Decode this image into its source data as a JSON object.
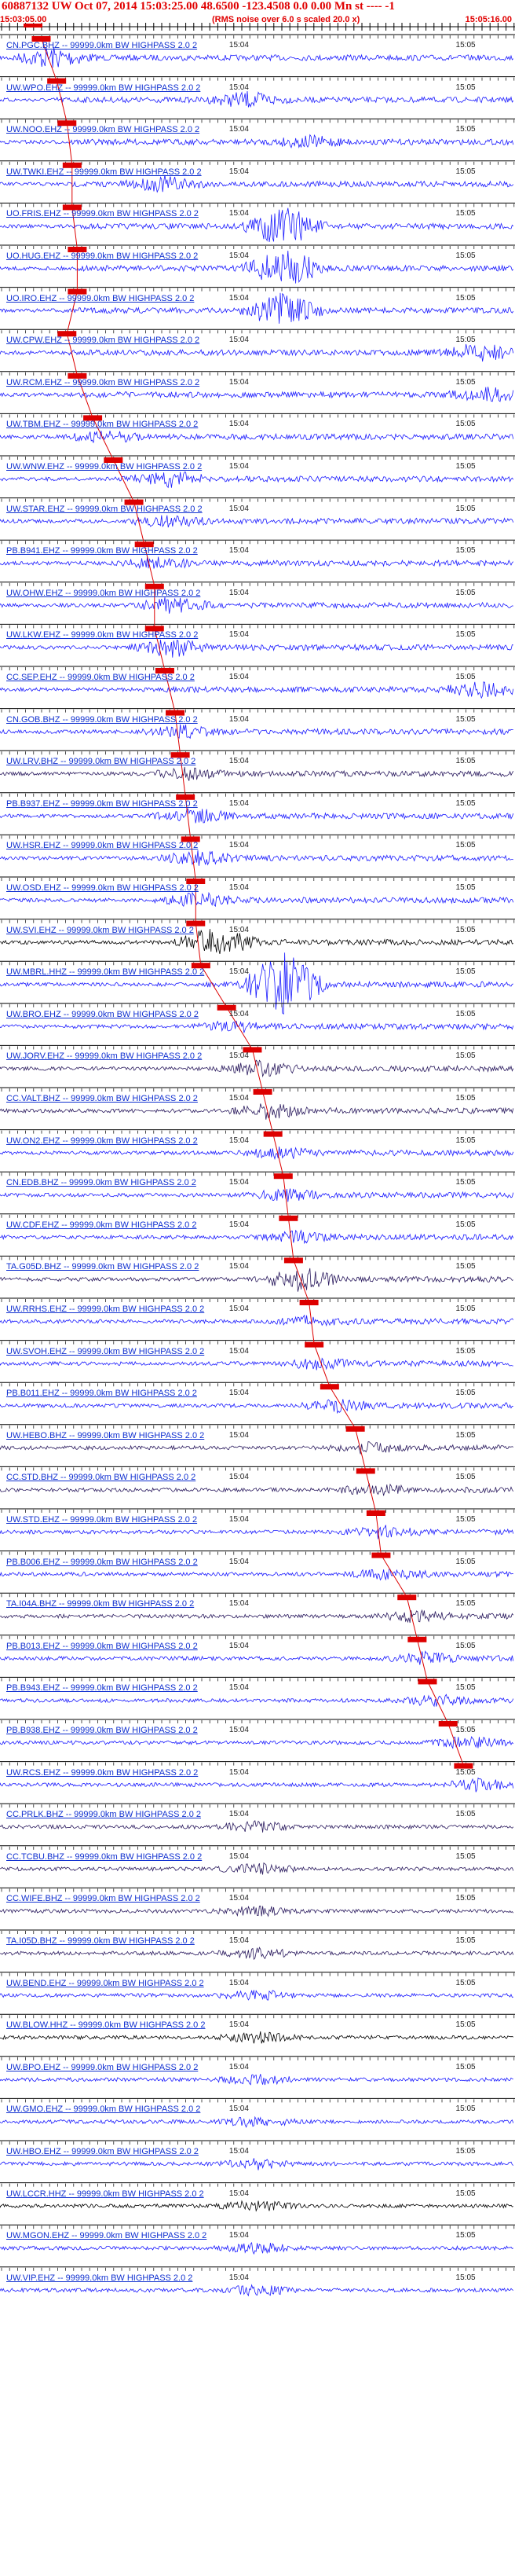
{
  "header": {
    "title": "60887132 UW Oct 07, 2014 15:03:25.00   48.6500 -123.4508  0.0 0.00 Mn st ----  -1",
    "start_time": "15:03:05.00",
    "noise_note": "(RMS noise over 6.0 s scaled 20.0 x)",
    "end_time": "15:05:16.00"
  },
  "time_tick_labels": [
    "15:04",
    "15:05"
  ],
  "colors": {
    "title": "#e00000",
    "label": "#1030d0",
    "trace_blue": "#1a1aff",
    "trace_dark": "#2a1a5e",
    "trace_black": "#000000",
    "pick": "#dd0000"
  },
  "channels": [
    {
      "label": "CN.PGC.BHZ -- 99999.0km BW  HIGHPASS  2.0  2",
      "color": "#1a1aff",
      "amp": 6,
      "burst": 0.1,
      "pick": 0.08
    },
    {
      "label": "UW.WPO.EHZ -- 99999.0km BW  HIGHPASS  2.0  2",
      "color": "#1a1aff",
      "amp": 4,
      "burst": 0.48,
      "pick": 0.11
    },
    {
      "label": "UW.NOO.EHZ -- 99999.0km BW  HIGHPASS  2.0  2",
      "color": "#1a1aff",
      "amp": 3,
      "burst": 0.6,
      "pick": 0.13
    },
    {
      "label": "UW.TWKI.EHZ -- 99999.0km BW  HIGHPASS  2.0  2",
      "color": "#1a1aff",
      "amp": 4,
      "burst": 0.32,
      "pick": 0.14
    },
    {
      "label": "UO.FRIS.EHZ -- 99999.0km BW  HIGHPASS  2.0  2",
      "color": "#1a1aff",
      "amp": 12,
      "burst": 0.55,
      "pick": 0.14
    },
    {
      "label": "UO.HUG.EHZ -- 99999.0km BW  HIGHPASS  2.0  2",
      "color": "#1a1aff",
      "amp": 12,
      "burst": 0.55,
      "pick": 0.15
    },
    {
      "label": "UO.IRO.EHZ -- 99999.0km BW  HIGHPASS  2.0  2",
      "color": "#1a1aff",
      "amp": 10,
      "burst": 0.55,
      "pick": 0.15
    },
    {
      "label": "UW.CPW.EHZ -- 99999.0km BW  HIGHPASS  2.0  2",
      "color": "#1a1aff",
      "amp": 5,
      "burst": 0.93,
      "pick": 0.13
    },
    {
      "label": "UW.RCM.EHZ -- 99999.0km BW  HIGHPASS  2.0  2",
      "color": "#1a1aff",
      "amp": 4,
      "burst": 0.95,
      "pick": 0.15
    },
    {
      "label": "UW.TBM.EHZ -- 99999.0km BW  HIGHPASS  2.0  2",
      "color": "#1a1aff",
      "amp": 3,
      "burst": 0.2,
      "pick": 0.18
    },
    {
      "label": "UW.WNW.EHZ -- 99999.0km BW  HIGHPASS  2.0  2",
      "color": "#1a1aff",
      "amp": 4,
      "burst": 0.33,
      "pick": 0.22
    },
    {
      "label": "UW.STAR.EHZ -- 99999.0km BW  HIGHPASS  2.0  2",
      "color": "#1a1aff",
      "amp": 3,
      "burst": 0.33,
      "pick": 0.26
    },
    {
      "label": "PB.B941.EHZ -- 99999.0km BW  HIGHPASS  2.0  2",
      "color": "#1a1aff",
      "amp": 3,
      "burst": 0.3,
      "pick": 0.28
    },
    {
      "label": "UW.OHW.EHZ -- 99999.0km BW  HIGHPASS  2.0  2",
      "color": "#1a1aff",
      "amp": 4,
      "burst": 0.33,
      "pick": 0.3
    },
    {
      "label": "UW.LKW.EHZ -- 99999.0km BW  HIGHPASS  2.0  2",
      "color": "#1a1aff",
      "amp": 5,
      "burst": 0.33,
      "pick": 0.3
    },
    {
      "label": "CC.SEP.EHZ -- 99999.0km BW  HIGHPASS  2.0  2",
      "color": "#1a1aff",
      "amp": 4,
      "burst": 0.94,
      "pick": 0.32
    },
    {
      "label": "CN.GOB.BHZ -- 99999.0km BW  HIGHPASS  2.0  2",
      "color": "#1a1aff",
      "amp": 3,
      "burst": 0.35,
      "pick": 0.34
    },
    {
      "label": "UW.LRV.BHZ -- 99999.0km BW  HIGHPASS  2.0  2",
      "color": "#2a1a5e",
      "amp": 3,
      "burst": 0.36,
      "pick": 0.35
    },
    {
      "label": "PB.B937.EHZ -- 99999.0km BW  HIGHPASS  2.0  2",
      "color": "#1a1aff",
      "amp": 4,
      "burst": 0.37,
      "pick": 0.36
    },
    {
      "label": "UW.HSR.EHZ -- 99999.0km BW  HIGHPASS  2.0  2",
      "color": "#1a1aff",
      "amp": 4,
      "burst": 0.38,
      "pick": 0.37
    },
    {
      "label": "UW.OSD.EHZ -- 99999.0km BW  HIGHPASS  2.0  2",
      "color": "#1a1aff",
      "amp": 4,
      "burst": 0.38,
      "pick": 0.38
    },
    {
      "label": "UW.SVI.EHZ -- 99999.0km BW  HIGHPASS  2.0  2",
      "color": "#000000",
      "amp": 9,
      "burst": 0.42,
      "pick": 0.38
    },
    {
      "label": "UW.MBRL.HHZ -- 99999.0km BW  HIGHPASS  2.0  2",
      "color": "#1a1aff",
      "amp": 20,
      "burst": 0.55,
      "pick": 0.39
    },
    {
      "label": "UW.BRO.EHZ -- 99999.0km BW  HIGHPASS  2.0  2",
      "color": "#1a1aff",
      "amp": 3,
      "burst": 0.45,
      "pick": 0.44
    },
    {
      "label": "UW.JORV.EHZ -- 99999.0km BW  HIGHPASS  2.0  2",
      "color": "#2a1a5e",
      "amp": 4,
      "burst": 0.5,
      "pick": 0.49
    },
    {
      "label": "CC.VALT.BHZ -- 99999.0km BW  HIGHPASS  2.0  2",
      "color": "#2a1a5e",
      "amp": 4,
      "burst": 0.52,
      "pick": 0.51
    },
    {
      "label": "UW.ON2.EHZ -- 99999.0km BW  HIGHPASS  2.0  2",
      "color": "#1a1aff",
      "amp": 3,
      "burst": 0.54,
      "pick": 0.53
    },
    {
      "label": "CN.EDB.BHZ -- 99999.0km BW  HIGHPASS  2.0  2",
      "color": "#1a1aff",
      "amp": 3,
      "burst": 0.55,
      "pick": 0.55
    },
    {
      "label": "UW.CDF.EHZ -- 99999.0km BW  HIGHPASS  2.0  2",
      "color": "#1a1aff",
      "amp": 3,
      "burst": 0.57,
      "pick": 0.56
    },
    {
      "label": "TA.G05D.BHZ -- 99999.0km BW  HIGHPASS  2.0  2",
      "color": "#2a1a5e",
      "amp": 7,
      "burst": 0.58,
      "pick": 0.57
    },
    {
      "label": "UW.RRHS.EHZ -- 99999.0km BW  HIGHPASS  2.0  2",
      "color": "#1a1aff",
      "amp": 3,
      "burst": 0.6,
      "pick": 0.6
    },
    {
      "label": "UW.SVOH.EHZ -- 99999.0km BW  HIGHPASS  2.0  2",
      "color": "#1a1aff",
      "amp": 3,
      "burst": 0.61,
      "pick": 0.61
    },
    {
      "label": "PB.B011.EHZ -- 99999.0km BW  HIGHPASS  2.0  2",
      "color": "#1a1aff",
      "amp": 3,
      "burst": 0.65,
      "pick": 0.64
    },
    {
      "label": "UW.HEBO.BHZ -- 99999.0km BW  HIGHPASS  2.0  2",
      "color": "#2a1a5e",
      "amp": 3,
      "burst": 0.7,
      "pick": 0.69
    },
    {
      "label": "CC.STD.BHZ -- 99999.0km BW  HIGHPASS  2.0  2",
      "color": "#2a1a5e",
      "amp": 3,
      "burst": 0.72,
      "pick": 0.71
    },
    {
      "label": "UW.STD.EHZ -- 99999.0km BW  HIGHPASS  2.0  2",
      "color": "#1a1aff",
      "amp": 3,
      "burst": 0.74,
      "pick": 0.73
    },
    {
      "label": "PB.B006.EHZ -- 99999.0km BW  HIGHPASS  2.0  2",
      "color": "#1a1aff",
      "amp": 3,
      "burst": 0.75,
      "pick": 0.74
    },
    {
      "label": "TA.I04A.BHZ -- 99999.0km BW  HIGHPASS  2.0  2",
      "color": "#2a1a5e",
      "amp": 3,
      "burst": 0.8,
      "pick": 0.79
    },
    {
      "label": "PB.B013.EHZ -- 99999.0km BW  HIGHPASS  2.0  2",
      "color": "#1a1aff",
      "amp": 3,
      "burst": 0.82,
      "pick": 0.81
    },
    {
      "label": "PB.B943.EHZ -- 99999.0km BW  HIGHPASS  2.0  2",
      "color": "#1a1aff",
      "amp": 3,
      "burst": 0.84,
      "pick": 0.83
    },
    {
      "label": "PB.B938.EHZ -- 99999.0km BW  HIGHPASS  2.0  2",
      "color": "#1a1aff",
      "amp": 3,
      "burst": 0.9,
      "pick": 0.87
    },
    {
      "label": "UW.RCS.EHZ -- 99999.0km BW  HIGHPASS  2.0  2",
      "color": "#1a1aff",
      "amp": 3,
      "burst": 0.92,
      "pick": 0.9
    },
    {
      "label": "CC.PRLK.BHZ -- 99999.0km BW  HIGHPASS  2.0  2",
      "color": "#2a1a5e",
      "amp": 3,
      "burst": 0.5,
      "pick": null
    },
    {
      "label": "CC.TCBU.BHZ -- 99999.0km BW  HIGHPASS  2.0  2",
      "color": "#2a1a5e",
      "amp": 3,
      "burst": 0.5,
      "pick": null
    },
    {
      "label": "CC.WIFE.BHZ -- 99999.0km BW  HIGHPASS  2.0  2",
      "color": "#2a1a5e",
      "amp": 3,
      "burst": 0.5,
      "pick": null
    },
    {
      "label": "TA.I05D.BHZ -- 99999.0km BW  HIGHPASS  2.0  2",
      "color": "#2a1a5e",
      "amp": 3,
      "burst": 0.5,
      "pick": null
    },
    {
      "label": "UW.BEND.EHZ -- 99999.0km BW  HIGHPASS  2.0  2",
      "color": "#1a1aff",
      "amp": 3,
      "burst": 0.5,
      "pick": null
    },
    {
      "label": "UW.BLOW.HHZ -- 99999.0km BW  HIGHPASS  2.0  2",
      "color": "#000000",
      "amp": 3,
      "burst": 0.5,
      "pick": null
    },
    {
      "label": "UW.BPO.EHZ -- 99999.0km BW  HIGHPASS  2.0  2",
      "color": "#1a1aff",
      "amp": 3,
      "burst": 0.5,
      "pick": null
    },
    {
      "label": "UW.GMO.EHZ -- 99999.0km BW  HIGHPASS  2.0  2",
      "color": "#1a1aff",
      "amp": 3,
      "burst": 0.5,
      "pick": null
    },
    {
      "label": "UW.HBO.EHZ -- 99999.0km BW  HIGHPASS  2.0  2",
      "color": "#1a1aff",
      "amp": 3,
      "burst": 0.5,
      "pick": null
    },
    {
      "label": "UW.LCCR.HHZ -- 99999.0km BW  HIGHPASS  2.0  2",
      "color": "#000000",
      "amp": 3,
      "burst": 0.5,
      "pick": null
    },
    {
      "label": "UW.MGON.EHZ -- 99999.0km BW  HIGHPASS  2.0  2",
      "color": "#1a1aff",
      "amp": 3,
      "burst": 0.5,
      "pick": null
    },
    {
      "label": "UW.VIP.EHZ -- 99999.0km BW  HIGHPASS  2.0  2",
      "color": "#1a1aff",
      "amp": 3,
      "burst": 0.5,
      "pick": null
    }
  ]
}
